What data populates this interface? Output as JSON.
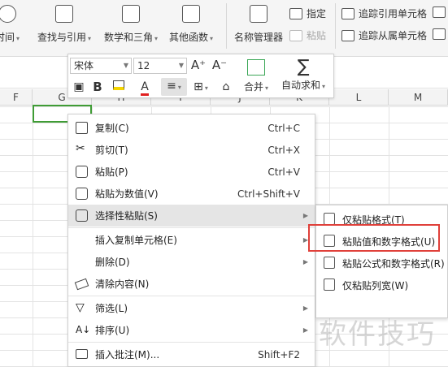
{
  "ribbon": {
    "buttons": [
      {
        "label": "时间",
        "icon": "clock-icon"
      },
      {
        "label": "查找与引用",
        "icon": "lookup-icon"
      },
      {
        "label": "数学和三角",
        "icon": "math-icon"
      },
      {
        "label": "其他函数",
        "icon": "more-functions-icon"
      },
      {
        "label": "名称管理器",
        "icon": "name-manager-icon"
      }
    ],
    "small": {
      "designate": "指定",
      "paste": "粘贴",
      "trace_precedents": "追踪引用单元格",
      "trace_dependents": "追踪从属单元格"
    }
  },
  "columns": [
    "F",
    "G",
    "H",
    "I",
    "J",
    "K",
    "L",
    "M"
  ],
  "mini_toolbar": {
    "font_name": "宋体",
    "font_size": "12",
    "grow_font": "A⁺",
    "shrink_font": "A⁻",
    "bold": "B",
    "font_color": "A",
    "merge_label": "合并",
    "autosum_label": "自动求和"
  },
  "context_menu": {
    "items": [
      {
        "label": "复制(C)",
        "shortcut": "Ctrl+C",
        "icon": "copy-icon"
      },
      {
        "label": "剪切(T)",
        "shortcut": "Ctrl+X",
        "icon": "scissors-icon"
      },
      {
        "label": "粘贴(P)",
        "shortcut": "Ctrl+V",
        "icon": "paste-icon"
      },
      {
        "label": "粘贴为数值(V)",
        "shortcut": "Ctrl+Shift+V",
        "icon": "paste-values-icon"
      },
      {
        "label": "选择性粘贴(S)",
        "shortcut": "",
        "icon": "paste-special-icon"
      },
      {
        "label": "插入复制单元格(E)",
        "shortcut": "",
        "icon": ""
      },
      {
        "label": "删除(D)",
        "shortcut": "",
        "icon": ""
      },
      {
        "label": "清除内容(N)",
        "shortcut": "",
        "icon": "eraser-icon"
      },
      {
        "label": "筛选(L)",
        "shortcut": "",
        "icon": "filter-icon"
      },
      {
        "label": "排序(U)",
        "shortcut": "",
        "icon": "sort-icon"
      },
      {
        "label": "插入批注(M)...",
        "shortcut": "Shift+F2",
        "icon": "comment-icon"
      }
    ]
  },
  "submenu": {
    "items": [
      {
        "label": "仅粘贴格式(T)"
      },
      {
        "label": "粘贴值和数字格式(U)"
      },
      {
        "label": "粘贴公式和数字格式(R)"
      },
      {
        "label": "仅粘贴列宽(W)"
      }
    ]
  },
  "watermark": "软件技巧",
  "colors": {
    "selection": "#3f9c35",
    "highlight_box": "#e0403a",
    "hover": "#e5e5e5"
  }
}
